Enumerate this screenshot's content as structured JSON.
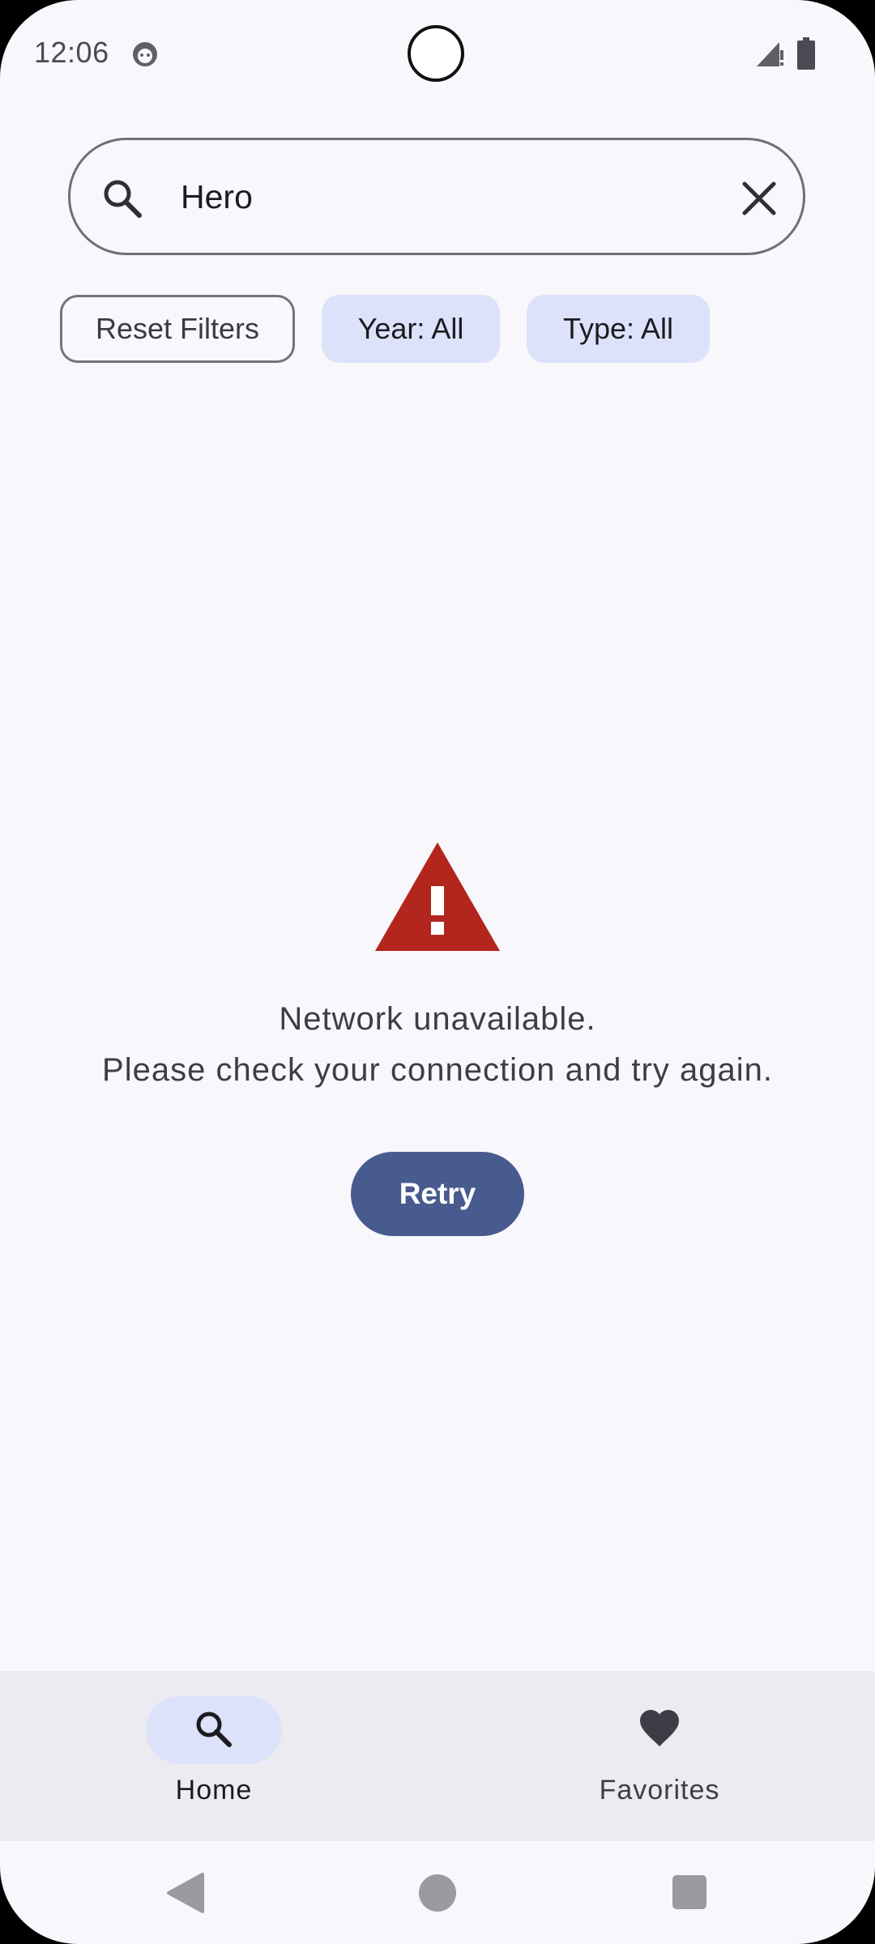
{
  "status_bar": {
    "time": "12:06"
  },
  "search": {
    "value": "Hero",
    "placeholder": ""
  },
  "filters": {
    "reset_label": "Reset Filters",
    "year_label": "Year: All",
    "type_label": "Type: All"
  },
  "error": {
    "line1": "Network unavailable.",
    "line2": "Please check your connection and try again.",
    "retry_label": "Retry"
  },
  "bottom_nav": {
    "items": [
      {
        "label": "Home",
        "icon": "search-icon",
        "selected": true
      },
      {
        "label": "Favorites",
        "icon": "heart-icon",
        "selected": false
      }
    ]
  },
  "colors": {
    "background": "#f8f7fc",
    "chip_bg": "#dde2fb",
    "primary": "#485b8f",
    "warning": "#b3261e",
    "nav_bg": "#ecebf1"
  }
}
